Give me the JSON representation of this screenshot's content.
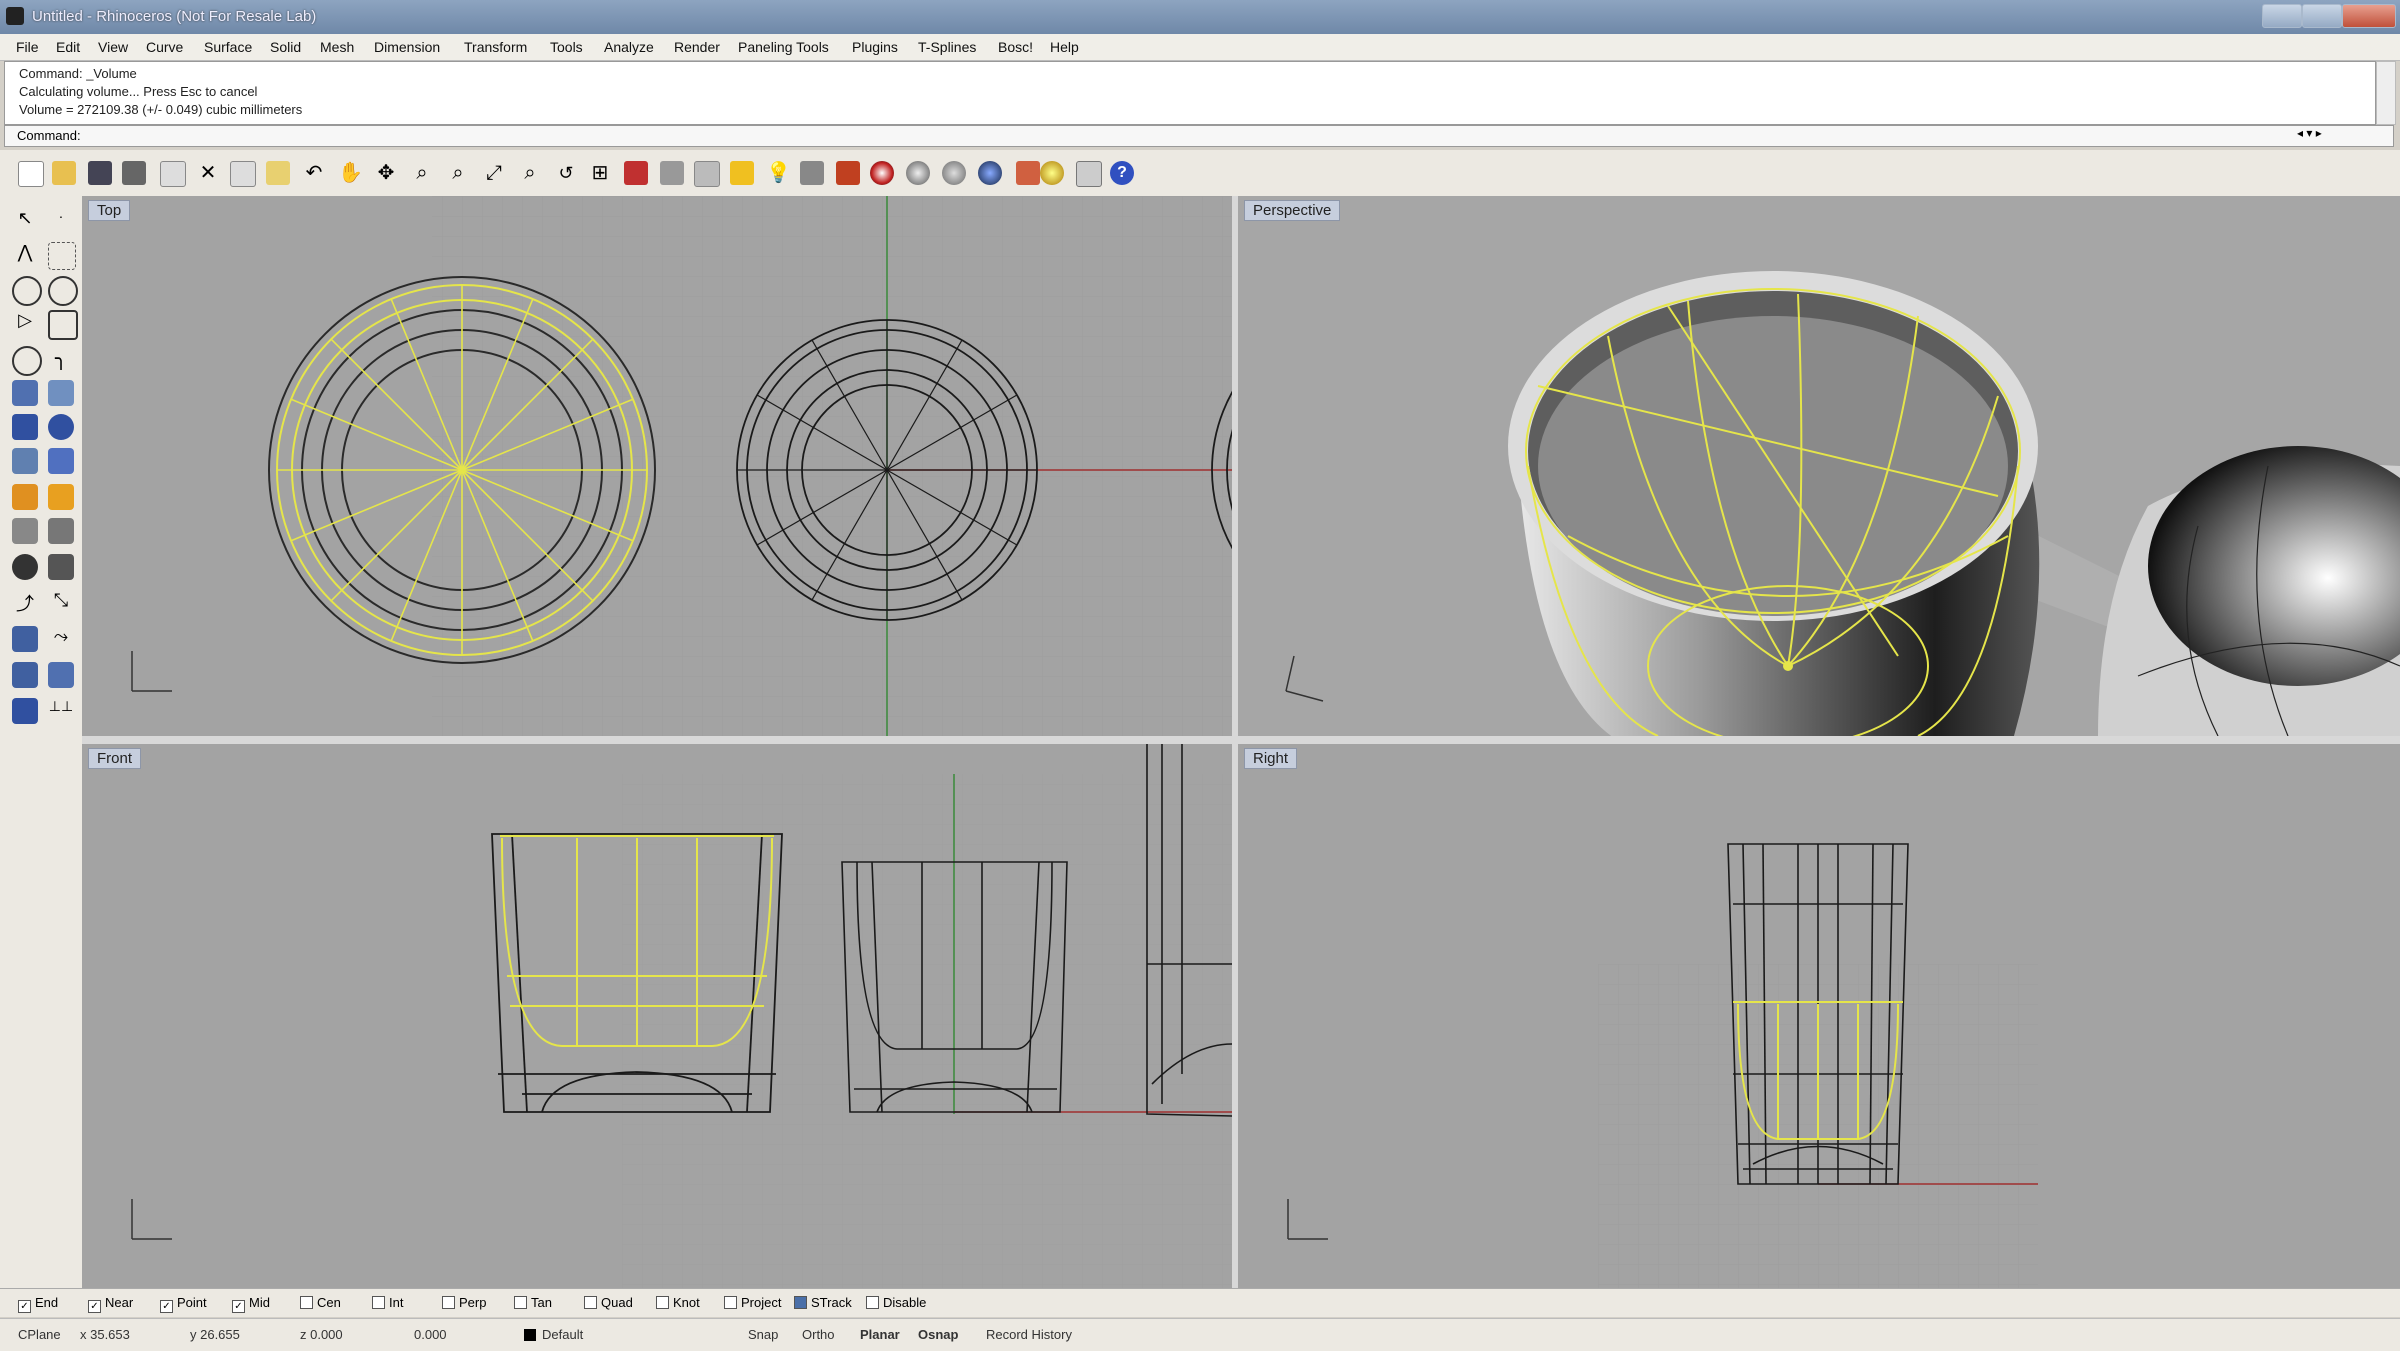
{
  "window": {
    "title": "Untitled - Rhinoceros (Not For Resale Lab)"
  },
  "menu": [
    "File",
    "Edit",
    "View",
    "Curve",
    "Surface",
    "Solid",
    "Mesh",
    "Dimension",
    "Transform",
    "Tools",
    "Analyze",
    "Render",
    "Paneling Tools",
    "Plugins",
    "T-Splines",
    "Bosc!",
    "Help"
  ],
  "history": [
    "Command: _Volume",
    "Calculating volume... Press Esc to cancel",
    "Volume = 272109.38 (+/- 0.049) cubic millimeters"
  ],
  "command": {
    "label": "Command:"
  },
  "viewports": {
    "top": {
      "label": "Top"
    },
    "perspective": {
      "label": "Perspective"
    },
    "front": {
      "label": "Front"
    },
    "right": {
      "label": "Right"
    }
  },
  "osnaps": [
    {
      "label": "End",
      "checked": true
    },
    {
      "label": "Near",
      "checked": true
    },
    {
      "label": "Point",
      "checked": true
    },
    {
      "label": "Mid",
      "checked": true
    },
    {
      "label": "Cen",
      "checked": false
    },
    {
      "label": "Int",
      "checked": false
    },
    {
      "label": "Perp",
      "checked": false
    },
    {
      "label": "Tan",
      "checked": false
    },
    {
      "label": "Quad",
      "checked": false
    },
    {
      "label": "Knot",
      "checked": false
    },
    {
      "label": "Project",
      "checked": false
    },
    {
      "label": "STrack",
      "checked": true
    },
    {
      "label": "Disable",
      "checked": false
    }
  ],
  "status": {
    "cplane": "CPlane",
    "x": "x 35.653",
    "y": "y 26.655",
    "z": "z 0.000",
    "dist": "0.000",
    "layer": "Default",
    "modes": [
      "Snap",
      "Ortho",
      "Planar",
      "Osnap",
      "Record History"
    ]
  },
  "colors": {
    "viewport_bg": "#a3a3a3",
    "selection": "#e5e54a",
    "wire": "#1a1a1a"
  }
}
